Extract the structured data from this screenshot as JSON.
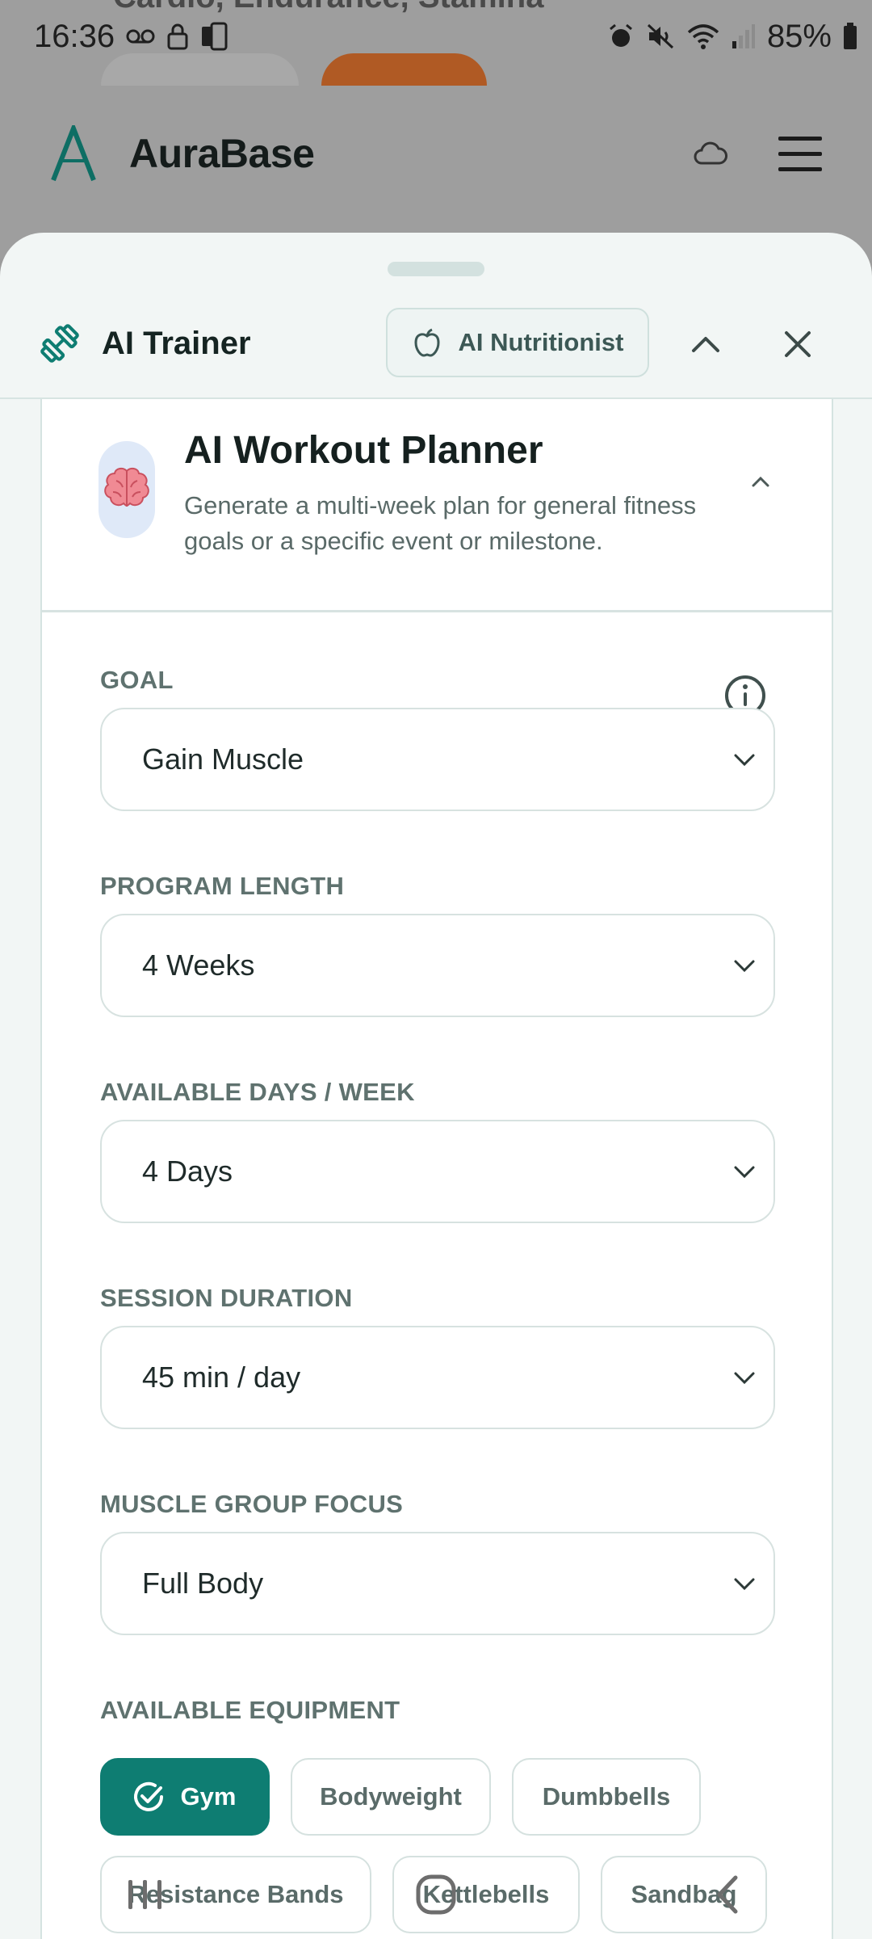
{
  "background": {
    "ghost_text": "Cardio, Endurance, Stamina"
  },
  "status_bar": {
    "time": "16:36",
    "battery_percent": "85%"
  },
  "app_header": {
    "brand_name": "AuraBase"
  },
  "sheet": {
    "title": "AI Trainer",
    "nutritionist_button": "AI Nutritionist"
  },
  "planner": {
    "title": "AI Workout Planner",
    "description": "Generate a multi-week plan for general fitness goals or a specific event or milestone."
  },
  "form": {
    "goal": {
      "label": "GOAL",
      "value": "Gain Muscle"
    },
    "program_length": {
      "label": "PROGRAM LENGTH",
      "value": "4 Weeks"
    },
    "days_per_week": {
      "label": "AVAILABLE DAYS / WEEK",
      "value": "4 Days"
    },
    "session_duration": {
      "label": "SESSION DURATION",
      "value": "45 min / day"
    },
    "muscle_focus": {
      "label": "MUSCLE GROUP FOCUS",
      "value": "Full Body"
    },
    "equipment": {
      "label": "AVAILABLE EQUIPMENT",
      "options": [
        "Gym",
        "Bodyweight",
        "Dumbbells",
        "Resistance Bands",
        "Kettlebells",
        "Sandbag"
      ],
      "selected": "Gym"
    }
  },
  "colors": {
    "accent": "#0e7d72",
    "sheet_bg": "#f2f6f5",
    "scrim": "#9e9e9e"
  }
}
